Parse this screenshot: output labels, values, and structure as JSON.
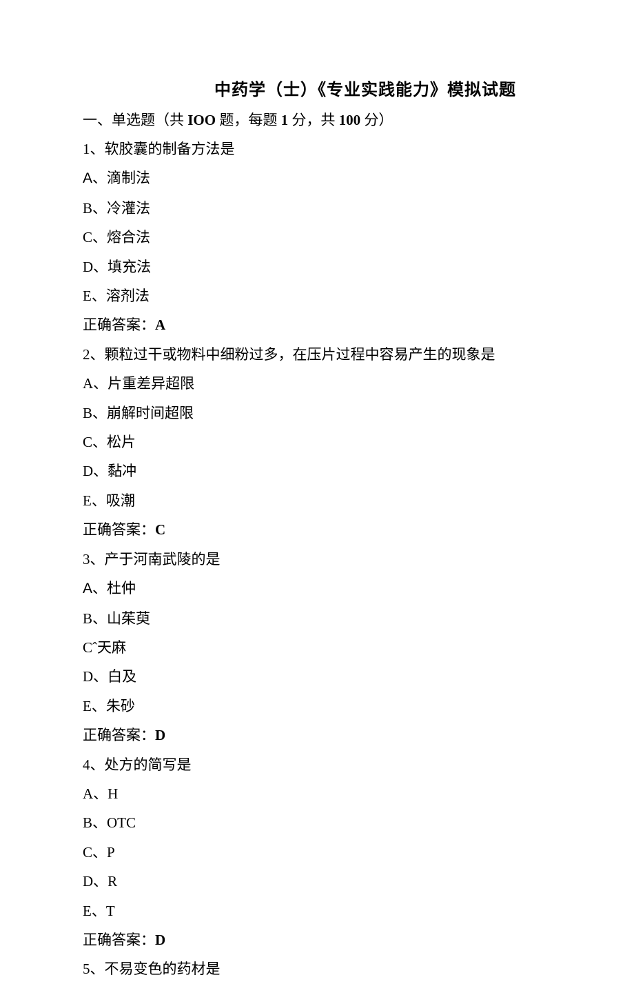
{
  "title": "中药学（士）《专业实践能力》模拟试题",
  "section_header": {
    "prefix": "一、单选题（共 ",
    "count_word": "IOO",
    "mid1": " 题，每题 ",
    "per": "1",
    "mid2": " 分，共 ",
    "total": "100",
    "suffix": " 分）"
  },
  "questions": [
    {
      "num": "1、",
      "text": "软胶囊的制备方法是",
      "options": [
        {
          "label": "A",
          "sep": "、",
          "text": "滴制法",
          "alt": true
        },
        {
          "label": "B",
          "sep": "、",
          "text": "冷灌法"
        },
        {
          "label": "C",
          "sep": "、",
          "text": "熔合法"
        },
        {
          "label": "D",
          "sep": "、",
          "text": "填充法"
        },
        {
          "label": "E",
          "sep": "、",
          "text": "溶剂法"
        }
      ],
      "answer_label": "正确答案：",
      "answer": "A"
    },
    {
      "num": "2、",
      "text": "颗粒过干或物料中细粉过多，在压片过程中容易产生的现象是",
      "options": [
        {
          "label": "A",
          "sep": "、",
          "text": "片重差异超限"
        },
        {
          "label": "B",
          "sep": "、",
          "text": "崩解时间超限"
        },
        {
          "label": "C",
          "sep": "、",
          "text": "松片"
        },
        {
          "label": "D",
          "sep": "、",
          "text": "黏冲"
        },
        {
          "label": "E",
          "sep": "、",
          "text": "吸潮"
        }
      ],
      "answer_label": "正确答案：",
      "answer": "C"
    },
    {
      "num": "3、",
      "text": "产于河南武陵的是",
      "options": [
        {
          "label": "A",
          "sep": "、",
          "text": "杜仲",
          "alt": true
        },
        {
          "label": "B",
          "sep": "、",
          "text": "山茱萸"
        },
        {
          "label": "Cˆ",
          "sep": "",
          "text": "天麻"
        },
        {
          "label": "D",
          "sep": "、",
          "text": "白及"
        },
        {
          "label": "E",
          "sep": "、",
          "text": "朱砂"
        }
      ],
      "answer_label": "正确答案：",
      "answer": "D"
    },
    {
      "num": "4、",
      "text": "处方的简写是",
      "options": [
        {
          "label": "A",
          "sep": "、",
          "text": "H"
        },
        {
          "label": "B",
          "sep": "、",
          "text": "OTC"
        },
        {
          "label": "C",
          "sep": "、",
          "text": "P"
        },
        {
          "label": "D",
          "sep": "、",
          "text": "R"
        },
        {
          "label": "E",
          "sep": "、",
          "text": "T"
        }
      ],
      "answer_label": "正确答案：",
      "answer": "D"
    },
    {
      "num": "5、",
      "text": "不易变色的药材是"
    }
  ]
}
